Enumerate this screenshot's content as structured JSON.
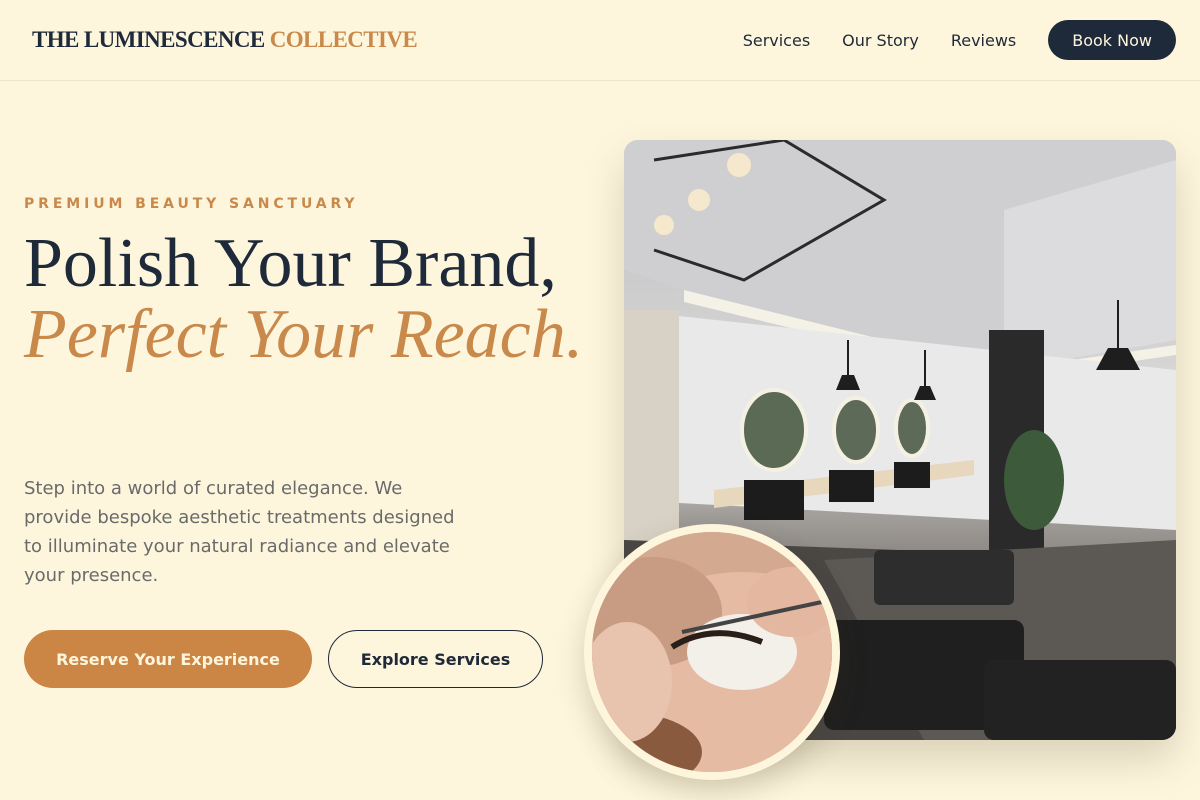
{
  "header": {
    "logo_main": "THE LUMINESCENCE",
    "logo_accent": "COLLECTIVE",
    "nav": [
      {
        "label": "Services"
      },
      {
        "label": "Our Story"
      },
      {
        "label": "Reviews"
      }
    ],
    "cta_label": "Book Now"
  },
  "hero": {
    "eyebrow": "PREMIUM BEAUTY SANCTUARY",
    "headline_line1": "Polish Your Brand,",
    "headline_italic": "Perfect Your Reach.",
    "lead": "Step into a world of curated elegance. We provide bespoke aesthetic treatments designed to illuminate your natural radiance and elevate your presence.",
    "primary_cta": "Reserve Your Experience",
    "secondary_cta": "Explore Services"
  },
  "colors": {
    "background": "#fdf6dd",
    "navy": "#1e2939",
    "accent": "#c8894a",
    "muted_text": "#6a6a6a"
  }
}
